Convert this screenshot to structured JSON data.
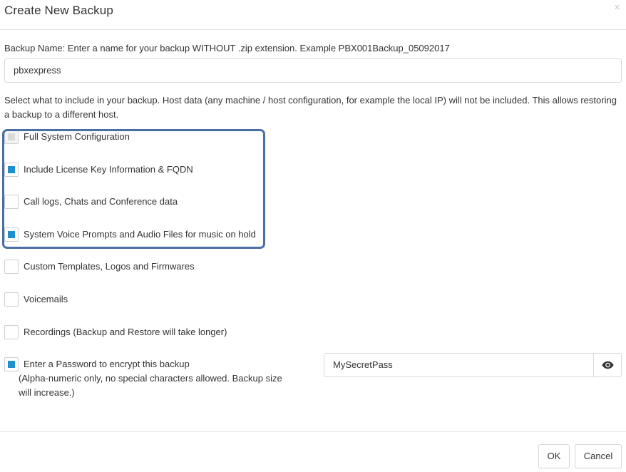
{
  "dialog": {
    "title": "Create New Backup",
    "close_glyph": "×"
  },
  "backup_name": {
    "label": "Backup Name: Enter a name for your backup WITHOUT .zip extension. Example PBX001Backup_05092017",
    "value": "pbxexpress"
  },
  "description": "Select what to include in your backup. Host data (any machine / host configuration, for example the local IP) will not be included. This allows restoring a backup to a different host.",
  "options": [
    {
      "label": "Full System Configuration",
      "checked": true,
      "disabled": true
    },
    {
      "label": "Include License Key Information & FQDN",
      "checked": true,
      "disabled": false
    },
    {
      "label": "Call logs, Chats and Conference data",
      "checked": false,
      "disabled": false
    },
    {
      "label": "System Voice Prompts and Audio Files for music on hold",
      "checked": true,
      "disabled": false
    },
    {
      "label": "Custom Templates, Logos and Firmwares",
      "checked": false,
      "disabled": false
    },
    {
      "label": "Voicemails",
      "checked": false,
      "disabled": false
    },
    {
      "label": "Recordings (Backup and Restore will take longer)",
      "checked": false,
      "disabled": false
    }
  ],
  "password": {
    "checkbox_label": "Enter a Password to encrypt this backup",
    "checked": true,
    "note": "(Alpha-numeric only, no special characters allowed. Backup size will increase.)",
    "value": "MySecretPass",
    "toggle_icon": "eye-icon"
  },
  "footer": {
    "ok_label": "OK",
    "cancel_label": "Cancel"
  },
  "colors": {
    "checkbox_fill": "#1e8fcf",
    "highlight_border": "#4a6fa5"
  }
}
